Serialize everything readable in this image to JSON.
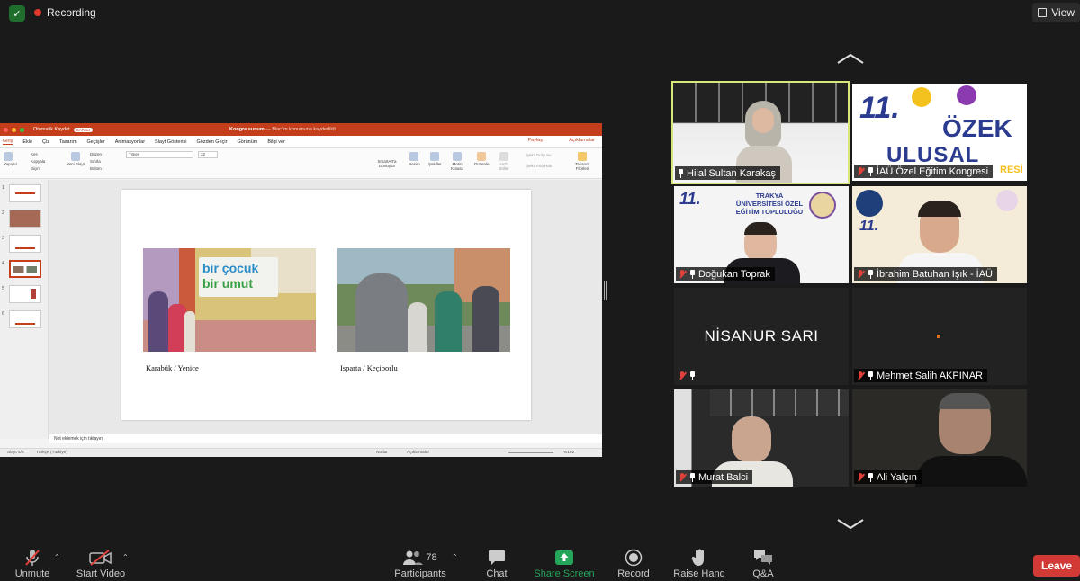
{
  "top": {
    "recording_label": "Recording",
    "view_label": "View"
  },
  "presentation": {
    "app_autosave": "Otomatik Kaydet",
    "autosave_state": "KAPALI",
    "doc_title": "Kongre sunum",
    "doc_status": "— Mac'im konumuna kaydedildi",
    "tabs": [
      "Giriş",
      "Ekle",
      "Çiz",
      "Tasarım",
      "Geçişler",
      "Animasyonlar",
      "Slayt Gösterisi",
      "Gözden Geçir",
      "Görünüm",
      "Bilgi ver"
    ],
    "share_label": "Paylaş",
    "comments_label": "Açıklamalar",
    "ribbon": {
      "paste": "Yapıştır",
      "cut": "Kes",
      "copy": "Kopyala",
      "format": "Biçim",
      "new_slide": "Yeni Slayt",
      "layout": "Düzen",
      "reset": "Sıfırla",
      "section": "Bölüm",
      "font": "Times",
      "font_size": "32",
      "smartart": "SmartArt'a Dönüştür",
      "picture": "Resim",
      "shapes": "Şekiller",
      "textbox": "Metin Kutusu",
      "arrange": "Düzenle",
      "quick_styles": "Hızlı Stiller",
      "shape_fill": "Şekil Dolgusu",
      "shape_outline": "Şekil Ana Hatı",
      "designer": "Tasarım Fikirleri"
    },
    "slide_numbers": [
      "1",
      "2",
      "3",
      "4",
      "5",
      "6"
    ],
    "slide": {
      "banner_line1": "bir çocuk",
      "banner_line2": "bir umut",
      "caption_left": "Karabük / Yenice",
      "caption_right": "Isparta / Keçiborlu"
    },
    "notes_placeholder": "Not eklemek için tıklayın",
    "status": {
      "slide_count": "Slayt 4/6",
      "language": "Türkçe (Türkiye)",
      "notes": "Notlar",
      "comments": "Açıklamalar",
      "zoom": "%102"
    }
  },
  "participants": [
    {
      "name": "Hilal Sultan Karakaş",
      "active": true,
      "muted": false
    },
    {
      "name": "İAÜ Özel Eğitim Kongresi",
      "muted": true,
      "overlay": "RESİ"
    },
    {
      "name": "Doğukan Toprak",
      "muted": true,
      "banner": "TRAKYA ÜNİVERSİTESİ ÖZEL EĞİTİM TOPLULUĞU"
    },
    {
      "name": "İbrahim Batuhan Işık - İAÜ",
      "muted": true
    },
    {
      "name": "",
      "display_name": "NİSANUR SARI",
      "muted": true
    },
    {
      "name": "Mehmet Salih AKPINAR",
      "muted": true
    },
    {
      "name": "Murat Balci",
      "muted": true
    },
    {
      "name": "Ali Yalçın",
      "muted": true
    }
  ],
  "logo": {
    "number": "11.",
    "line1": "ÖZEK",
    "line2": "ULUSAL"
  },
  "toolbar": {
    "unmute": "Unmute",
    "start_video": "Start Video",
    "participants": "Participants",
    "participant_count": "78",
    "chat": "Chat",
    "share_screen": "Share Screen",
    "record": "Record",
    "raise_hand": "Raise Hand",
    "qa": "Q&A",
    "leave": "Leave"
  },
  "colors": {
    "background": "#1a1a1a",
    "active_speaker_border": "#d8e67b",
    "share_green": "#23a55a",
    "leave_red": "#d13a35",
    "ppt_accent": "#c43e1c"
  }
}
